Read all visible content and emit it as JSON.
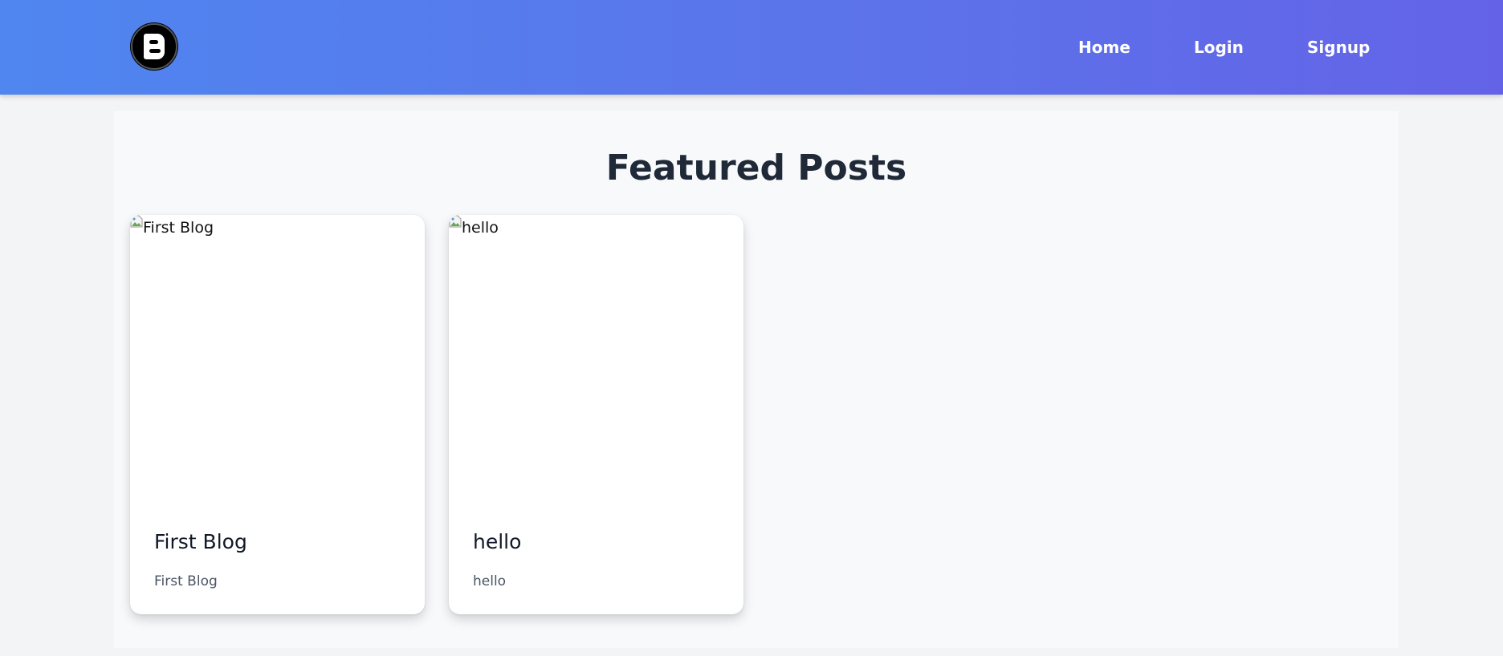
{
  "header": {
    "logo_icon": "blogger-b-icon",
    "nav": {
      "home": "Home",
      "login": "Login",
      "signup": "Signup"
    },
    "gradient": [
      "#4f86f0",
      "#6463e8"
    ]
  },
  "main": {
    "title": "Featured Posts",
    "posts": [
      {
        "image_alt": "First Blog",
        "title": "First Blog",
        "excerpt": "First Blog"
      },
      {
        "image_alt": "hello",
        "title": "hello",
        "excerpt": "hello"
      }
    ]
  }
}
